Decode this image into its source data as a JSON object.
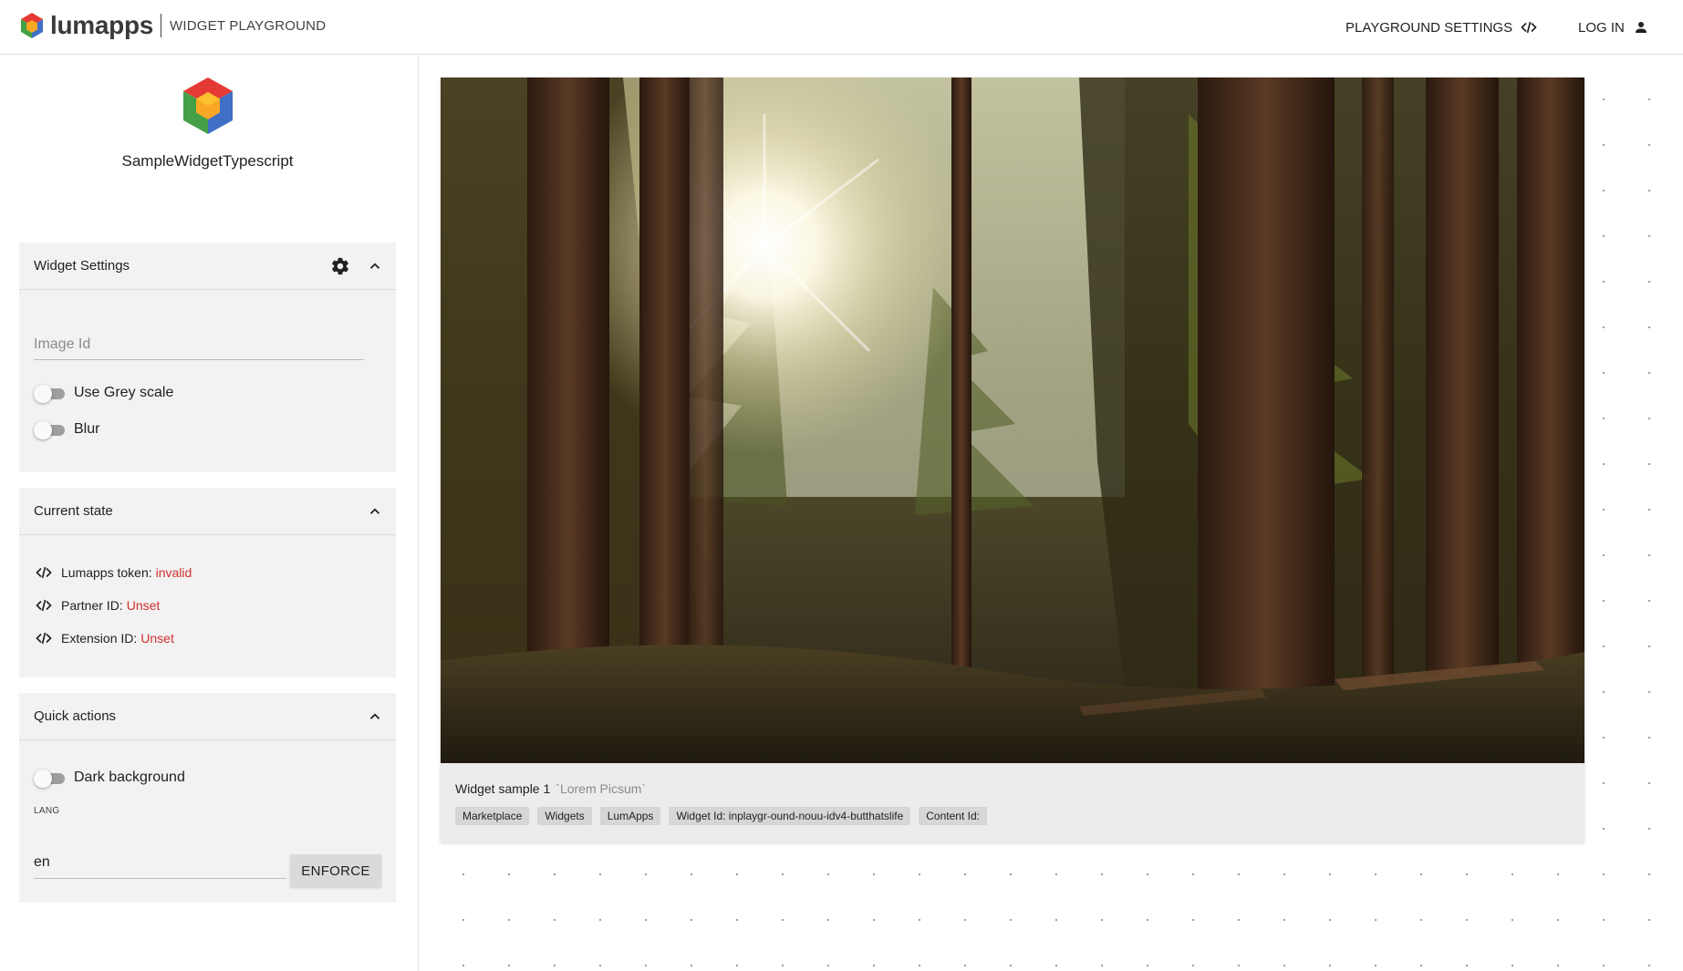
{
  "header": {
    "brand_name": "lumapps",
    "brand_sub": "WIDGET PLAYGROUND",
    "playground_settings_label": "PLAYGROUND SETTINGS",
    "login_label": "LOG IN"
  },
  "sidebar": {
    "widget_name": "SampleWidgetTypescript",
    "widget_settings": {
      "title": "Widget Settings",
      "image_id_placeholder": "Image Id",
      "image_id_value": "",
      "toggles": [
        {
          "label": "Use Grey scale",
          "checked": false
        },
        {
          "label": "Blur",
          "checked": false
        }
      ]
    },
    "current_state": {
      "title": "Current state",
      "rows": [
        {
          "label": "Lumapps token:",
          "value": "invalid"
        },
        {
          "label": "Partner ID:",
          "value": "Unset"
        },
        {
          "label": "Extension ID:",
          "value": "Unset"
        }
      ]
    },
    "quick_actions": {
      "title": "Quick actions",
      "dark_background_label": "Dark background",
      "dark_background_checked": false,
      "lang_label": "LANG",
      "lang_value": "en",
      "enforce_label": "ENFORCE"
    }
  },
  "widget_card": {
    "title": "Widget sample 1",
    "subtitle": "`Lorem Picsum`",
    "chips": [
      "Marketplace",
      "Widgets",
      "LumApps",
      "Widget Id: inplaygr-ound-nouu-idv4-butthatslife",
      "Content Id:"
    ]
  },
  "colors": {
    "error_red": "#d32f2f",
    "panel_bg": "#f2f2f2",
    "logo_red": "#e53935",
    "logo_green": "#43a047",
    "logo_blue": "#3f6fc6",
    "logo_orange": "#f9a825"
  },
  "icons": {
    "playground_settings": "code-icon",
    "login": "person-icon",
    "settings": "gear-icon",
    "collapse": "chevron-up-icon",
    "state_rows": "code-icon"
  }
}
